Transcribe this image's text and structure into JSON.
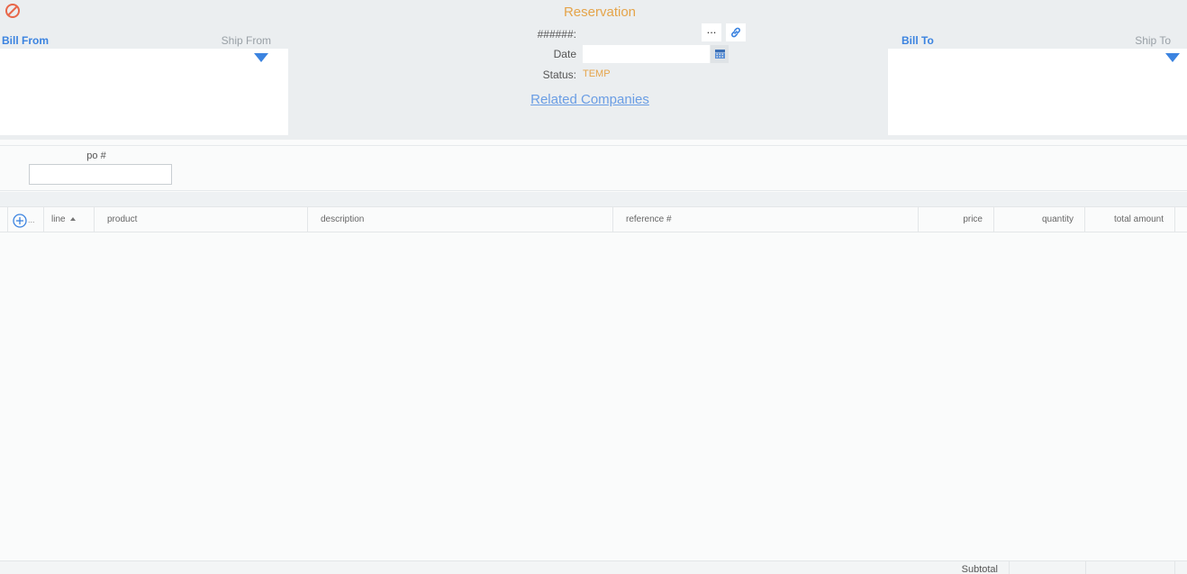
{
  "header": {
    "title": "Reservation",
    "cancel_icon": "cancel-icon"
  },
  "bill_from": {
    "active_tab": "Bill From",
    "inactive_tab": "Ship From"
  },
  "bill_to": {
    "active_tab": "Bill To",
    "inactive_tab": "Ship To"
  },
  "doc": {
    "number_label": "######:",
    "more_label": "...",
    "date_label": "Date",
    "date_value": "",
    "status_label": "Status:",
    "status_value": "TEMP",
    "related_link": "Related Companies"
  },
  "po": {
    "label": "po #",
    "value": ""
  },
  "grid": {
    "add_more": "...",
    "columns": {
      "line": "line",
      "product": "product",
      "description": "description",
      "reference": "reference #",
      "price": "price",
      "quantity": "quantity",
      "total": "total amount"
    },
    "rows": []
  },
  "footer": {
    "subtotal_label": "Subtotal"
  },
  "colors": {
    "accent": "#3b83e0",
    "title": "#e5a44a",
    "cancel": "#e8674a",
    "link": "#6a9de4"
  }
}
